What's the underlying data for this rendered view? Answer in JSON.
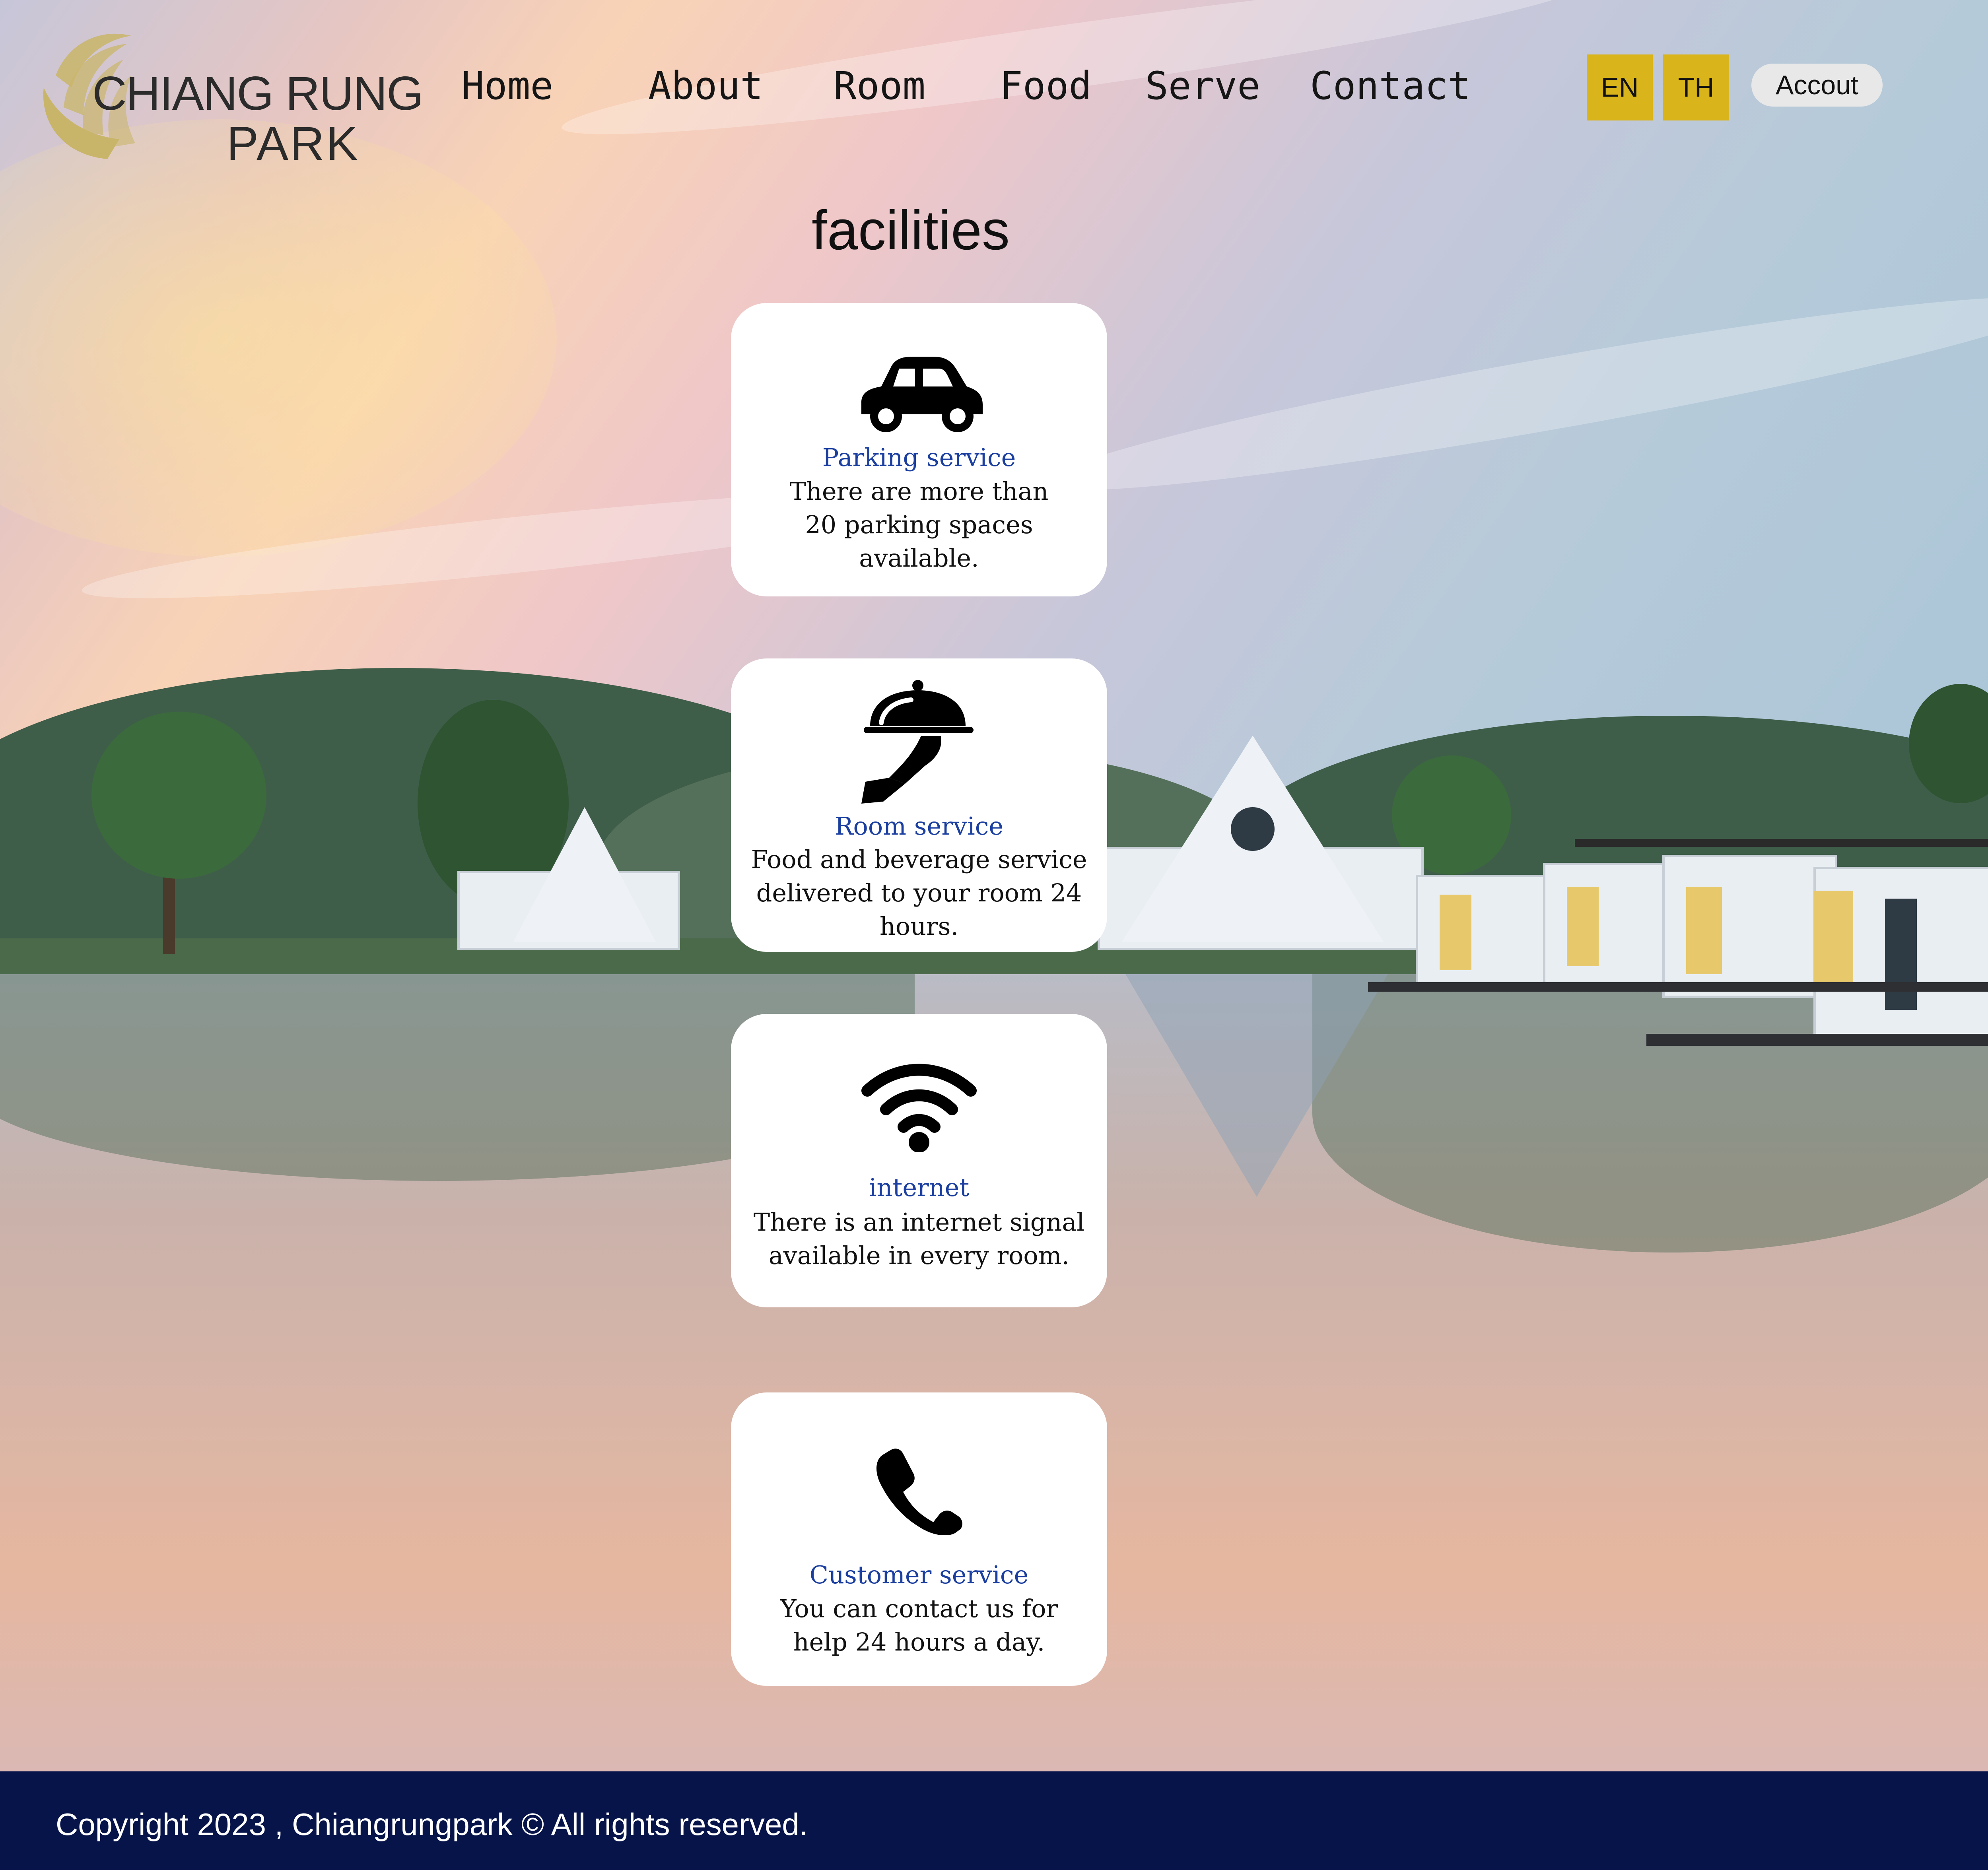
{
  "brand": {
    "line1": "CHIANG RUNG",
    "line2": "PARK",
    "gold": "#c9b56a"
  },
  "nav": {
    "items": [
      {
        "label": "Home"
      },
      {
        "label": "About"
      },
      {
        "label": "Room"
      },
      {
        "label": "Food"
      },
      {
        "label": "Serve"
      },
      {
        "label": "Contact"
      }
    ]
  },
  "lang": {
    "en": "EN",
    "th": "TH",
    "color": "#d9b41b"
  },
  "account": {
    "label": "Accout"
  },
  "main": {
    "title": "facilities",
    "cards": [
      {
        "icon": "car-icon",
        "title": "Parking service",
        "desc": "There are more than 20 parking spaces available."
      },
      {
        "icon": "room-service-icon",
        "title": "Room service",
        "desc": "Food and beverage service delivered to your room 24 hours."
      },
      {
        "icon": "wifi-icon",
        "title": "internet",
        "desc": "There is an internet signal available in every room."
      },
      {
        "icon": "phone-icon",
        "title": "Customer service",
        "desc": "You can contact us for help 24 hours a day."
      }
    ],
    "title_color": "#1b3fa0"
  },
  "footer": {
    "copyright": "Copyright 2023 , Chiangrungpark © All rights reserved.",
    "background": "#07144a"
  }
}
